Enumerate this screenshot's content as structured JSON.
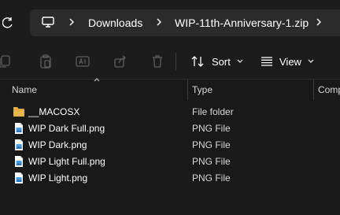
{
  "address_bar": {
    "breadcrumbs": [
      {
        "label": "Downloads"
      },
      {
        "label": "WIP-11th-Anniversary-1.zip"
      }
    ]
  },
  "toolbar": {
    "sort_label": "Sort",
    "view_label": "View"
  },
  "columns": {
    "name": "Name",
    "type": "Type",
    "compressed": "Comp"
  },
  "files": [
    {
      "name": "__MACOSX",
      "type": "File folder",
      "icon": "folder-icon"
    },
    {
      "name": "WIP Dark Full.png",
      "type": "PNG File",
      "icon": "png-file-icon"
    },
    {
      "name": "WIP Dark.png",
      "type": "PNG File",
      "icon": "png-file-icon"
    },
    {
      "name": "WIP Light Full.png",
      "type": "PNG File",
      "icon": "png-file-icon"
    },
    {
      "name": "WIP Light.png",
      "type": "PNG File",
      "icon": "png-file-icon"
    }
  ],
  "colors": {
    "background": "#191919",
    "folder": "#e8b64a",
    "png_icon": "#4a9be8"
  }
}
